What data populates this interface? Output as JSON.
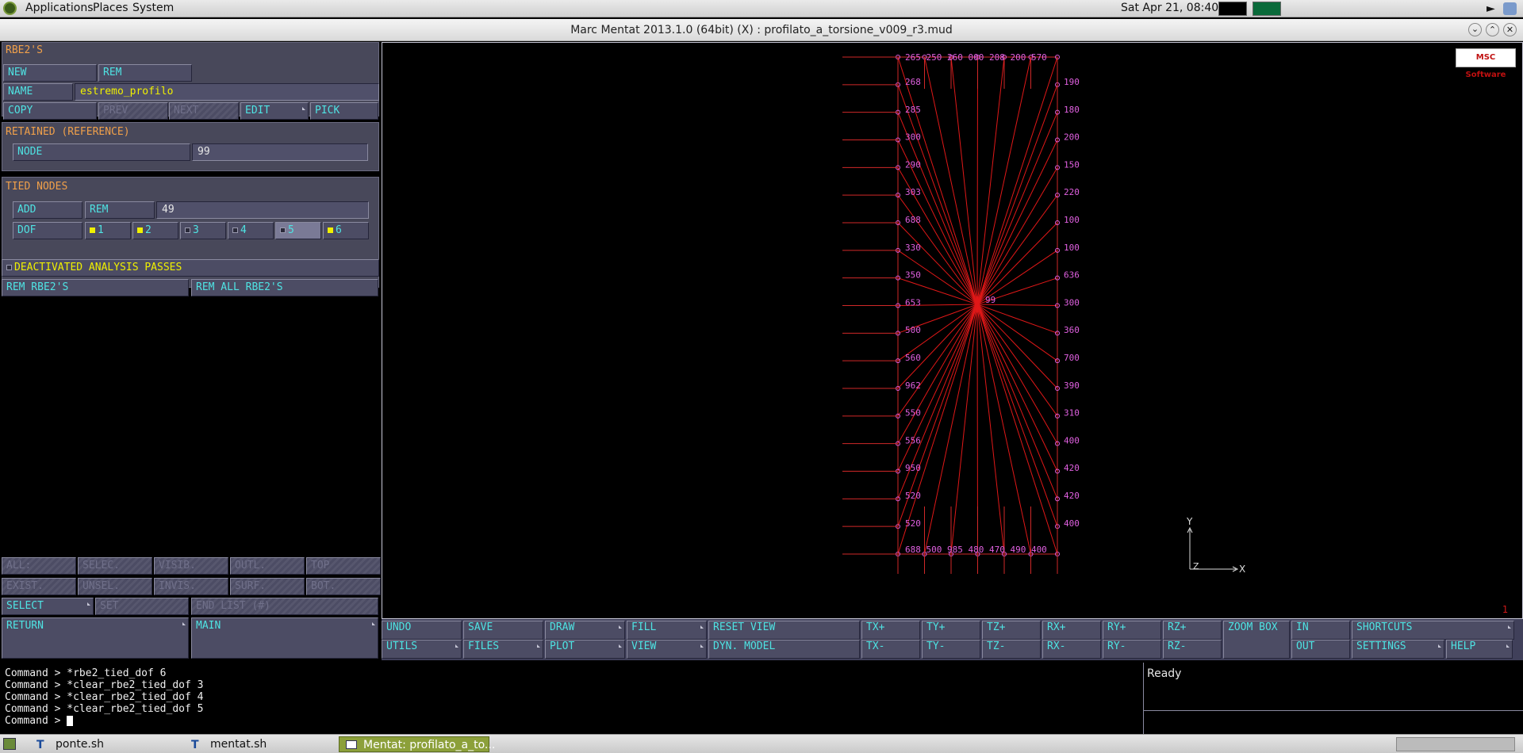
{
  "top_panel": {
    "applications": "Applications",
    "places": "Places",
    "system": "System",
    "clock": "Sat Apr 21, 08:40"
  },
  "window": {
    "title": "Marc Mentat 2013.1.0 (64bit) (X) : profilato_a_torsione_v009_r3.mud"
  },
  "rbe2": {
    "header": "RBE2'S",
    "new": "NEW",
    "rem": "REM",
    "name_label": "NAME",
    "name_value": "estremo_profilo",
    "copy": "COPY",
    "prev": "PREV",
    "next": "NEXT",
    "edit": "EDIT",
    "pick": "PICK"
  },
  "retained": {
    "header": "RETAINED (REFERENCE)",
    "node_label": "NODE",
    "node_value": "99"
  },
  "tied": {
    "header": "TIED NODES",
    "add": "ADD",
    "rem": "REM",
    "count": "49",
    "dof_label": "DOF",
    "dofs": [
      {
        "label": "1",
        "on": true
      },
      {
        "label": "2",
        "on": true
      },
      {
        "label": "3",
        "on": false
      },
      {
        "label": "4",
        "on": false
      },
      {
        "label": "5",
        "on": false
      },
      {
        "label": "6",
        "on": true
      }
    ]
  },
  "deactivated": "DEACTIVATED ANALYSIS PASSES",
  "rem_rbe2": "REM RBE2'S",
  "rem_all_rbe2": "REM ALL RBE2'S",
  "select_grid": {
    "row1": [
      "ALL:",
      "SELEC.",
      "VISIB.",
      "OUTL.",
      "TOP"
    ],
    "row2": [
      "EXIST.",
      "UNSEL.",
      "INVIS.",
      "SURF.",
      "BOT."
    ]
  },
  "select": "SELECT",
  "set": "SET",
  "end_list": "END LIST (#)",
  "return": "RETURN",
  "main": "MAIN",
  "viewport": {
    "logo": "MSC Software",
    "number": "1",
    "center_node": "99",
    "axis_x": "X",
    "axis_y": "Y",
    "axis_z": "Z",
    "left_labels": [
      "268",
      "285",
      "300",
      "290",
      "303",
      "688",
      "330",
      "350",
      "653",
      "500",
      "560",
      "962",
      "550",
      "556",
      "950",
      "520",
      "520"
    ],
    "right_labels": [
      "190",
      "180",
      "200",
      "150",
      "220",
      "100",
      "100",
      "636",
      "300",
      "360",
      "700",
      "390",
      "310",
      "400",
      "420",
      "420",
      "400"
    ],
    "top_labels": "265 250 260 000 208 200 570",
    "bottom_labels": "688 500 985 480 470 490 400"
  },
  "toolbar": {
    "undo": "UNDO",
    "utils": "UTILS",
    "save": "SAVE",
    "files": "FILES",
    "draw": "DRAW",
    "plot": "PLOT",
    "fill": "FILL",
    "view": "VIEW",
    "reset_view": "RESET VIEW",
    "dyn_model": "DYN. MODEL",
    "txp": "TX+",
    "txm": "TX-",
    "typ": "TY+",
    "tym": "TY-",
    "tzp": "TZ+",
    "tzm": "TZ-",
    "rxp": "RX+",
    "rxm": "RX-",
    "ryp": "RY+",
    "rym": "RY-",
    "rzp": "RZ+",
    "rzm": "RZ-",
    "zoom_box": "ZOOM BOX",
    "in": "IN",
    "out": "OUT",
    "shortcuts": "SHORTCUTS",
    "settings": "SETTINGS",
    "help": "HELP"
  },
  "commands": [
    "Command > *rbe2_tied_dof 6",
    "Command > *clear_rbe2_tied_dof 3",
    "Command > *clear_rbe2_tied_dof 4",
    "Command > *clear_rbe2_tied_dof 5",
    "Command > "
  ],
  "status": "Ready",
  "taskbar": {
    "t1": "ponte.sh",
    "t2": "mentat.sh",
    "t3": "Mentat: profilato_a_to..."
  }
}
